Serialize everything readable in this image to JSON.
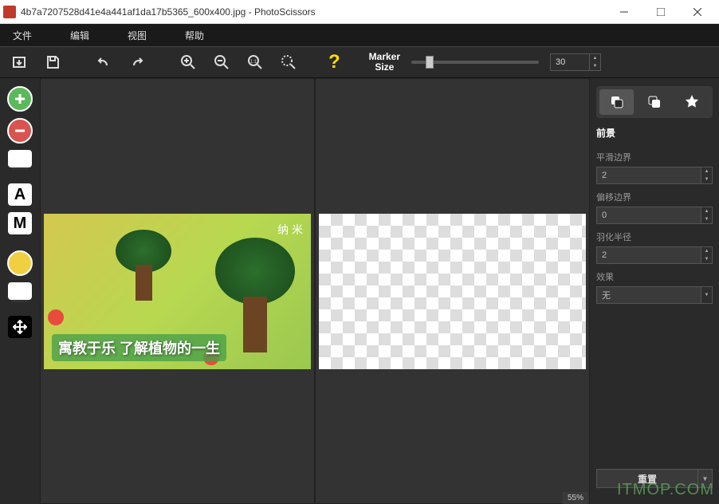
{
  "window": {
    "title": "4b7a7207528d41e4a441af1da17b5365_600x400.jpg - PhotoScissors"
  },
  "menu": {
    "file": "文件",
    "edit": "编辑",
    "view": "视图",
    "help": "帮助"
  },
  "toolbar": {
    "marker_label_1": "Marker",
    "marker_label_2": "Size",
    "marker_value": "30"
  },
  "image": {
    "caption": "寓教于乐 了解植物的一生",
    "brand": "纳 米"
  },
  "sidebar": {
    "section": "前景",
    "smooth_label": "平滑边界",
    "smooth_value": "2",
    "offset_label": "偏移边界",
    "offset_value": "0",
    "feather_label": "羽化半径",
    "feather_value": "2",
    "effect_label": "效果",
    "effect_value": "无",
    "reset": "重置"
  },
  "status": {
    "zoom": "55%"
  },
  "watermark": "ITMOP.COM"
}
